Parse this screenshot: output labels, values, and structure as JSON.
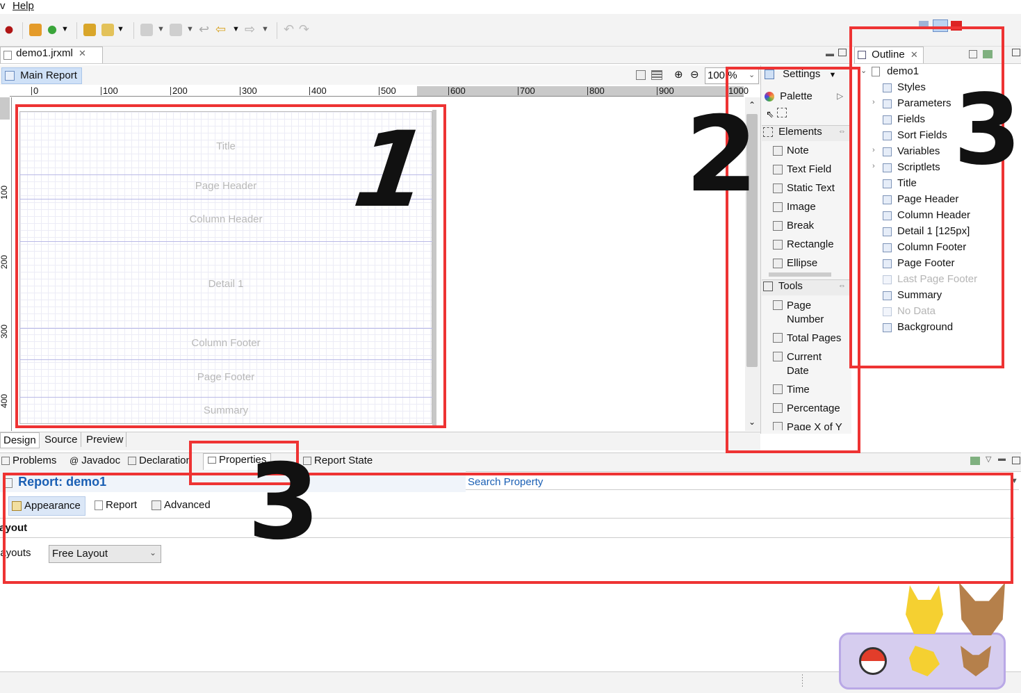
{
  "menubar": {
    "items": [
      "v",
      "Help"
    ]
  },
  "editor": {
    "file_tab": "demo1.jrxml",
    "report_tab": "Main Report",
    "zoom": "100 %",
    "ruler_h": [
      "0",
      "100",
      "200",
      "300",
      "400",
      "500",
      "600",
      "700",
      "800",
      "900",
      "1000"
    ],
    "ruler_v": [
      "100",
      "200",
      "300",
      "400"
    ],
    "bands": [
      "Title",
      "Page Header",
      "Column Header",
      "Detail 1",
      "Column Footer",
      "Page Footer",
      "Summary"
    ],
    "bottom_tabs": [
      "Design",
      "Source",
      "Preview"
    ]
  },
  "palette": {
    "settings_label": "Settings",
    "palette_label": "Palette",
    "elements_header": "Elements",
    "elements": [
      "Note",
      "Text Field",
      "Static Text",
      "Image",
      "Break",
      "Rectangle",
      "Ellipse"
    ],
    "tools_header": "Tools",
    "tools": [
      "Page\nNumber",
      "Total Pages",
      "Current\nDate",
      "Time",
      "Percentage",
      "Page X of Y"
    ]
  },
  "outline": {
    "title": "Outline",
    "root": "demo1",
    "items": [
      {
        "label": "Styles",
        "expandable": false,
        "disabled": false
      },
      {
        "label": "Parameters",
        "expandable": true,
        "disabled": false
      },
      {
        "label": "Fields",
        "expandable": false,
        "disabled": false
      },
      {
        "label": "Sort Fields",
        "expandable": false,
        "disabled": false
      },
      {
        "label": "Variables",
        "expandable": true,
        "disabled": false
      },
      {
        "label": "Scriptlets",
        "expandable": true,
        "disabled": false
      },
      {
        "label": "Title",
        "expandable": false,
        "disabled": false
      },
      {
        "label": "Page Header",
        "expandable": false,
        "disabled": false
      },
      {
        "label": "Column Header",
        "expandable": false,
        "disabled": false
      },
      {
        "label": "Detail 1 [125px]",
        "expandable": false,
        "disabled": false
      },
      {
        "label": "Column Footer",
        "expandable": false,
        "disabled": false
      },
      {
        "label": "Page Footer",
        "expandable": false,
        "disabled": false
      },
      {
        "label": "Last Page Footer",
        "expandable": false,
        "disabled": true
      },
      {
        "label": "Summary",
        "expandable": false,
        "disabled": false
      },
      {
        "label": "No Data",
        "expandable": false,
        "disabled": true
      },
      {
        "label": "Background",
        "expandable": false,
        "disabled": false
      }
    ]
  },
  "bottom_panel": {
    "tabs": [
      "Problems",
      "Javadoc",
      "Declaration",
      "Properties",
      "Report State"
    ],
    "report_title": "Report: demo1",
    "search_placeholder": "Search Property",
    "subtabs": [
      "Appearance",
      "Report",
      "Advanced"
    ],
    "section_title": "Layout",
    "layouts_label": "Layouts",
    "layouts_value": "Free Layout"
  },
  "annotations": [
    "1",
    "2",
    "3",
    "3"
  ],
  "colors": {
    "annotation_red": "#ee3333",
    "link_blue": "#1a5fb4",
    "band_line": "#b9b9e6"
  }
}
